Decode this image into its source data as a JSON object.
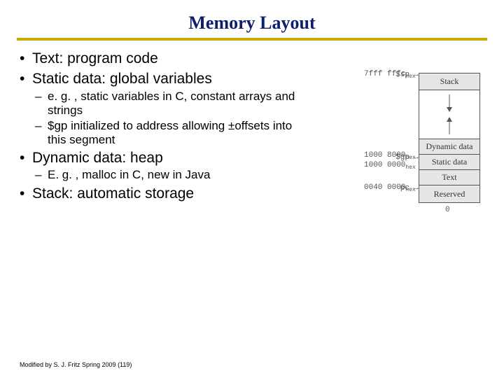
{
  "title": "Memory Layout",
  "bullets": {
    "b1": "Text: program code",
    "b2": "Static data: global variables",
    "b2_sub1": "e. g. , static variables in C, constant arrays and strings",
    "b2_sub2": "$gp initialized to address allowing ±offsets into this segment",
    "b3": "Dynamic data: heap",
    "b3_sub1": "E. g. , malloc in C, new in Java",
    "b4": "Stack: automatic storage"
  },
  "diagram": {
    "segments": {
      "stack": "Stack",
      "dynamic": "Dynamic data",
      "static": "Static data",
      "text": "Text",
      "reserved": "Reserved"
    },
    "pointers": {
      "sp": "$sp",
      "gp": "$gp",
      "pc": "pc"
    },
    "arrow": "→",
    "addrs": {
      "top": "7fff fffc",
      "gp1": "1000 8000",
      "gp2": "1000 0000",
      "pc": "0040 0000",
      "zero": "0",
      "suffix": "hex"
    }
  },
  "footer": "Modified by S. J. Fritz  Spring 2009 (119)"
}
